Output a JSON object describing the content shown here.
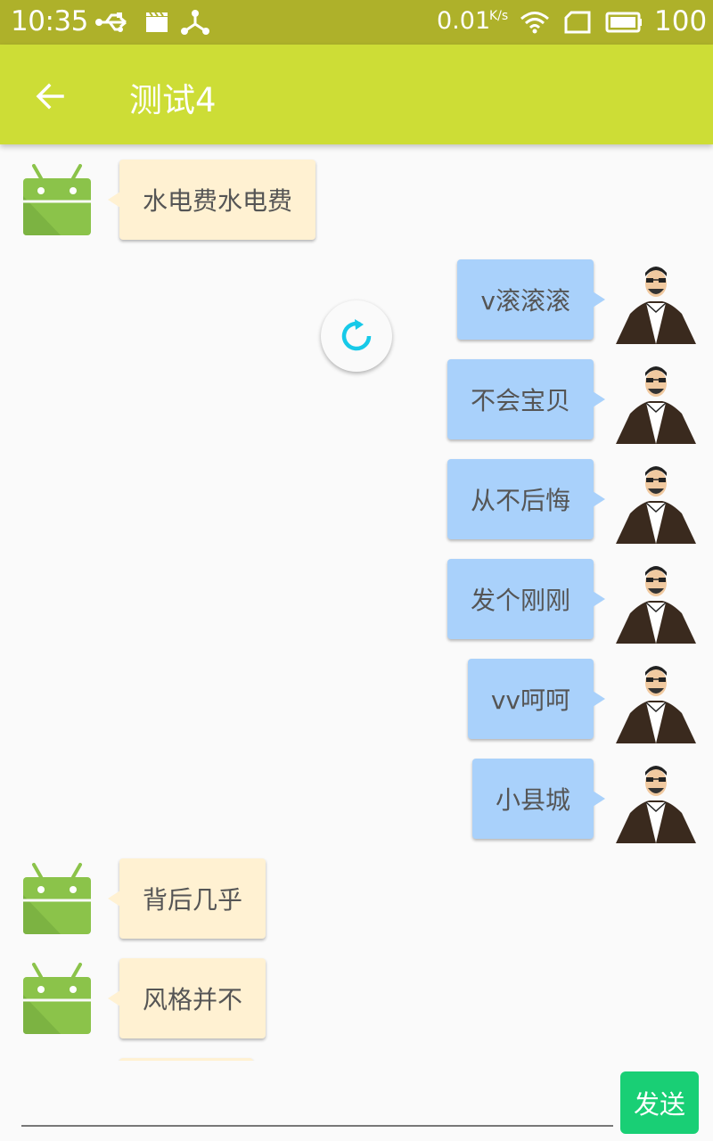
{
  "status_bar": {
    "time": "10:35",
    "net_speed": "0.01",
    "net_speed_unit": "K/s",
    "battery": "100",
    "icons": [
      "usb-icon",
      "clapperboard-icon",
      "share-icon",
      "wifi-icon",
      "sim-card-icon",
      "battery-icon"
    ]
  },
  "toolbar": {
    "title": "测试4",
    "back_icon": "arrow-back-icon",
    "background": "#cddd36"
  },
  "messages": [
    {
      "side": "left",
      "text": "水电费水电费"
    },
    {
      "side": "right",
      "text": "v滚滚滚"
    },
    {
      "side": "right",
      "text": "不会宝贝"
    },
    {
      "side": "right",
      "text": "从不后悔"
    },
    {
      "side": "right",
      "text": "发个刚刚"
    },
    {
      "side": "right",
      "text": "vv呵呵"
    },
    {
      "side": "right",
      "text": "小县城"
    },
    {
      "side": "left",
      "text": "背后几乎"
    },
    {
      "side": "left",
      "text": "风格并不"
    }
  ],
  "colors": {
    "left_bubble": "#fff1d2",
    "right_bubble": "#a9d1fb",
    "send_button": "#19cf75",
    "refresh_accent": "#17c9e8"
  },
  "input": {
    "value": "",
    "placeholder": ""
  },
  "send_button": {
    "label": "发送"
  }
}
